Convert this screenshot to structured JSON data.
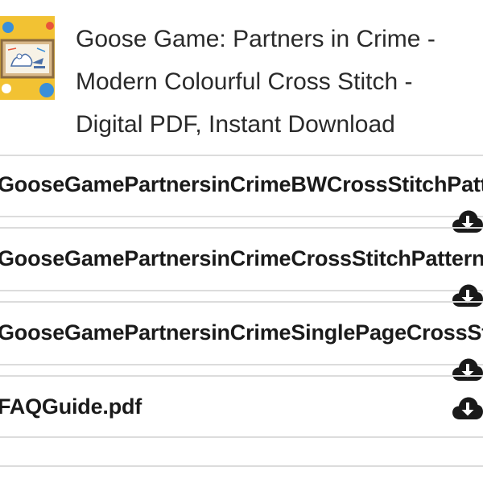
{
  "product": {
    "title_lines": [
      "Goose Game: Partners in Crime -",
      "Modern Colourful Cross Stitch -",
      "Digital PDF, Instant Download"
    ]
  },
  "files": [
    {
      "name": "GooseGamePartnersinCrimeBWCrossStitchPattern.pdf",
      "icon": "cloud-download-icon"
    },
    {
      "name": "GooseGamePartnersinCrimeCrossStitchPattern.pdf",
      "icon": "cloud-download-icon"
    },
    {
      "name": "GooseGamePartnersinCrimeSinglePageCrossStitchPattern.pdf",
      "icon": "cloud-download-icon"
    },
    {
      "name": "FAQGuide.pdf",
      "icon": "cloud-download-icon"
    }
  ],
  "colors": {
    "text": "#1a1a1a",
    "divider": "#dcdcdc",
    "thumbnail_bg": "#f2c233",
    "icon": "#1a1a1a"
  }
}
